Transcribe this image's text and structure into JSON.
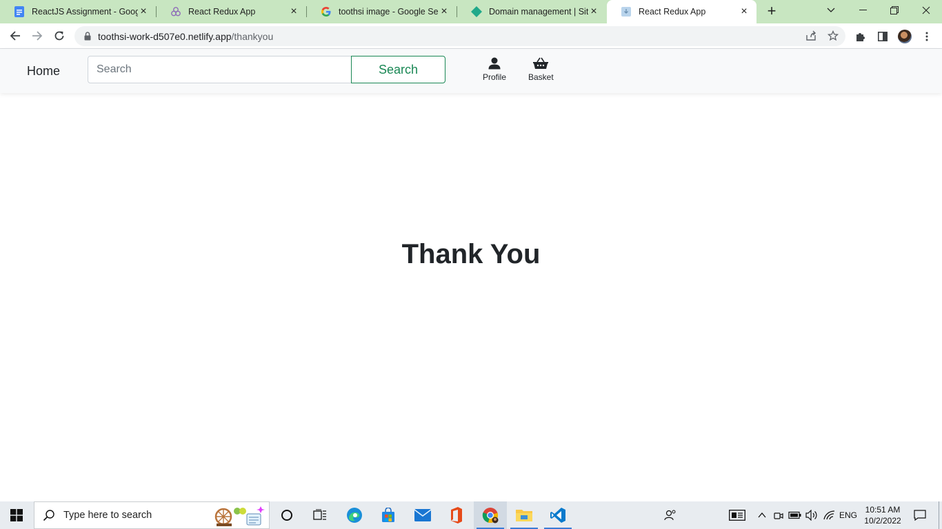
{
  "browser": {
    "tabs": [
      {
        "title": "ReactJS Assignment - Google Docs",
        "favicon": "google-docs-icon"
      },
      {
        "title": "React Redux App",
        "favicon": "netlify-icon"
      },
      {
        "title": "toothsi image - Google Search",
        "favicon": "google-icon"
      },
      {
        "title": "Domain management | Site settings",
        "favicon": "netlify-diamond-icon"
      },
      {
        "title": "React Redux App",
        "favicon": "page-icon",
        "active": true
      }
    ],
    "url_host": "toothsi-work-d507e0.netlify.app",
    "url_path": "/thankyou"
  },
  "navbar": {
    "brand": "Home",
    "search_placeholder": "Search",
    "search_button": "Search",
    "profile_label": "Profile",
    "basket_label": "Basket"
  },
  "main": {
    "heading": "Thank You"
  },
  "taskbar": {
    "search_placeholder": "Type here to search",
    "language": "ENG",
    "time": "10:51 AM",
    "date": "10/2/2022"
  },
  "colors": {
    "tabstrip": "#c8e6c1",
    "accent_green": "#198754",
    "navbar_bg": "#f8f9fa"
  }
}
